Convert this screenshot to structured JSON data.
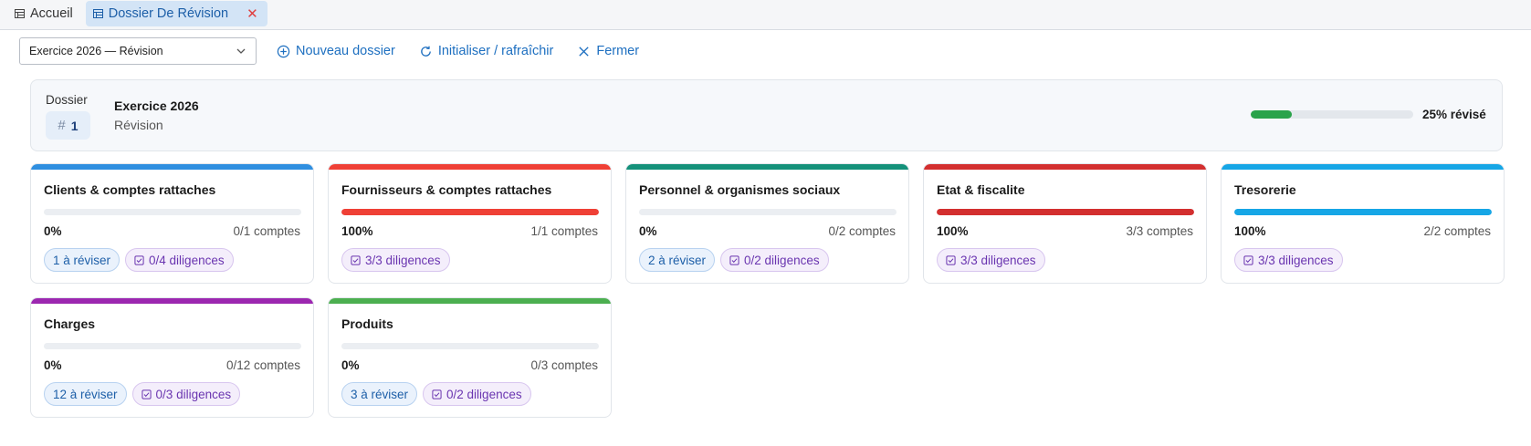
{
  "tabs": [
    {
      "label": "Accueil",
      "active": false
    },
    {
      "label": "Dossier De Révision",
      "active": true
    }
  ],
  "toolbar": {
    "select_value": "Exercice 2026 — Révision",
    "new_label": "Nouveau dossier",
    "refresh_label": "Initialiser / rafraîchir",
    "close_label": "Fermer"
  },
  "header": {
    "dossier_label": "Dossier",
    "dossier_number": "1",
    "title": "Exercice 2026",
    "subtitle": "Révision",
    "progress_percent": 25,
    "progress_label": "25% révisé"
  },
  "cards": [
    {
      "title": "Clients & comptes rattaches",
      "color": "#2f8fe0",
      "percent": 0,
      "pct_label": "0%",
      "count": "0/1 comptes",
      "to_review": "1 à réviser",
      "diligences": "0/4 diligences"
    },
    {
      "title": "Fournisseurs & comptes rattaches",
      "color": "#ef4036",
      "percent": 100,
      "pct_label": "100%",
      "count": "1/1 comptes",
      "to_review": null,
      "diligences": "3/3 diligences"
    },
    {
      "title": "Personnel & organismes sociaux",
      "color": "#14917a",
      "percent": 0,
      "pct_label": "0%",
      "count": "0/2 comptes",
      "to_review": "2 à réviser",
      "diligences": "0/2 diligences"
    },
    {
      "title": "Etat & fiscalite",
      "color": "#d32f2f",
      "percent": 100,
      "pct_label": "100%",
      "count": "3/3 comptes",
      "to_review": null,
      "diligences": "3/3 diligences"
    },
    {
      "title": "Tresorerie",
      "color": "#16a6e6",
      "percent": 100,
      "pct_label": "100%",
      "count": "2/2 comptes",
      "to_review": null,
      "diligences": "3/3 diligences"
    },
    {
      "title": "Charges",
      "color": "#9c27b0",
      "percent": 0,
      "pct_label": "0%",
      "count": "0/12 comptes",
      "to_review": "12 à réviser",
      "diligences": "0/3 diligences"
    },
    {
      "title": "Produits",
      "color": "#4caf50",
      "percent": 0,
      "pct_label": "0%",
      "count": "0/3 comptes",
      "to_review": "3 à réviser",
      "diligences": "0/2 diligences"
    }
  ]
}
